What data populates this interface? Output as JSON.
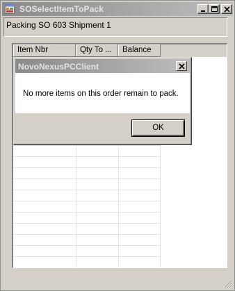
{
  "window": {
    "title": "SOSelectItemToPack",
    "icon": "app-form-icon",
    "buttons": {
      "minimize": "minimize-icon",
      "maximize": "maximize-icon",
      "close": "close-icon"
    }
  },
  "header": {
    "label": "Packing SO 603 Shipment 1"
  },
  "grid": {
    "columns": [
      "Item Nbr",
      "Qty To ...",
      "Balance"
    ],
    "rows": []
  },
  "dialog": {
    "title": "NovoNexusPCClient",
    "message": "No more items on this order remain to pack.",
    "ok_label": "OK"
  },
  "colors": {
    "chrome": "#d4d0c8",
    "inactive_title_start": "#8a8a8a",
    "inactive_title_end": "#bdbdbd",
    "inactive_title_text": "#e4e4e4"
  }
}
